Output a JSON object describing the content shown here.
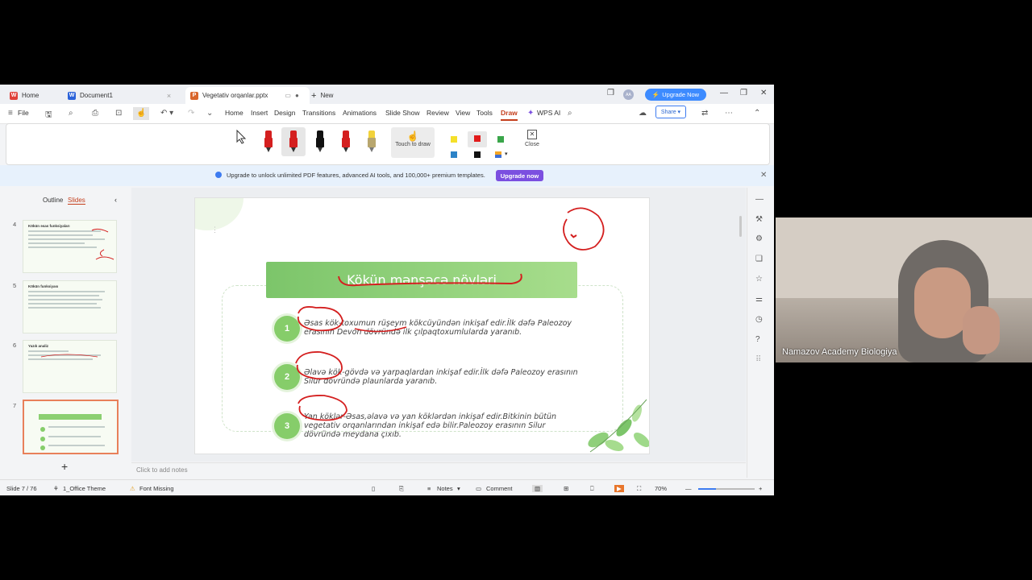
{
  "tabs": [
    {
      "label": "Home",
      "icon": "wps-icon"
    },
    {
      "label": "Document1",
      "icon": "word-icon"
    },
    {
      "label": "Vegetativ orqanlar.pptx",
      "icon": "ppt-icon"
    },
    {
      "label": "New",
      "icon": "plus-icon"
    }
  ],
  "account": {
    "upgrade_label": "Upgrade Now",
    "avatar_text": "AA"
  },
  "menu": {
    "file": "File",
    "items": [
      "Home",
      "Insert",
      "Design",
      "Transitions",
      "Animations",
      "Slide Show",
      "Review",
      "View",
      "Tools",
      "Draw",
      "WPS AI"
    ],
    "active": "Draw",
    "share": "Share"
  },
  "ribbon": {
    "touch_to_draw": "Touch to draw",
    "close": "Close",
    "pen_colors": [
      "#d41f1f",
      "#d41f1f",
      "#111111",
      "#d41f1f",
      "#f2d23a"
    ],
    "swatches": [
      "#f5e02a",
      "#e11b1b",
      "#3aa64a",
      "#2c83c7",
      "#111111",
      "#3d6fd6"
    ]
  },
  "banner": {
    "text": "Upgrade to unlock unlimited PDF features, advanced AI tools, and 100,000+ premium templates.",
    "button": "Upgrade now"
  },
  "left_panel": {
    "tab_outline": "Outline",
    "tab_slides": "Slides",
    "slides": [
      {
        "number": "4",
        "title": "Kökün əsas funksiyaları"
      },
      {
        "number": "5",
        "title": "Kökün funksiyası"
      },
      {
        "number": "6",
        "title": "Yazılı analiz"
      },
      {
        "number": "7",
        "title": "Kökün mənşəcə növləri"
      }
    ]
  },
  "slide": {
    "title": "Kökün mənşəcə növləri",
    "items": [
      {
        "num": "1",
        "text": "Əsas kök-toxumun rüşeym kökcüyündən inkişaf edir.İlk dəfə Paleozoy erasının Devon dövründə ilk çılpaqtoxumlularda yaranıb."
      },
      {
        "num": "2",
        "text": "Əlavə kök-gövdə və yarpaqlardan inkişaf edir.İlk dəfə Paleozoy erasının Silur dövründə plaunlarda yaranıb."
      },
      {
        "num": "3",
        "text": "Yan köklər-Əsas,əlavə və yan köklərdən inkişaf edir.Bitkinin bütün vegetativ orqanlarından inkişaf edə bilir.Paleozoy erasının Silur dövründə meydana çıxıb."
      }
    ]
  },
  "notes_placeholder": "Click to add notes",
  "status": {
    "slide_info": "Slide 7 / 76",
    "theme": "1_Office Theme",
    "font_missing": "Font Missing",
    "notes": "Notes",
    "comment": "Comment",
    "zoom": "70%"
  },
  "webcam": {
    "name": "Namazov Academy Biologiya"
  }
}
